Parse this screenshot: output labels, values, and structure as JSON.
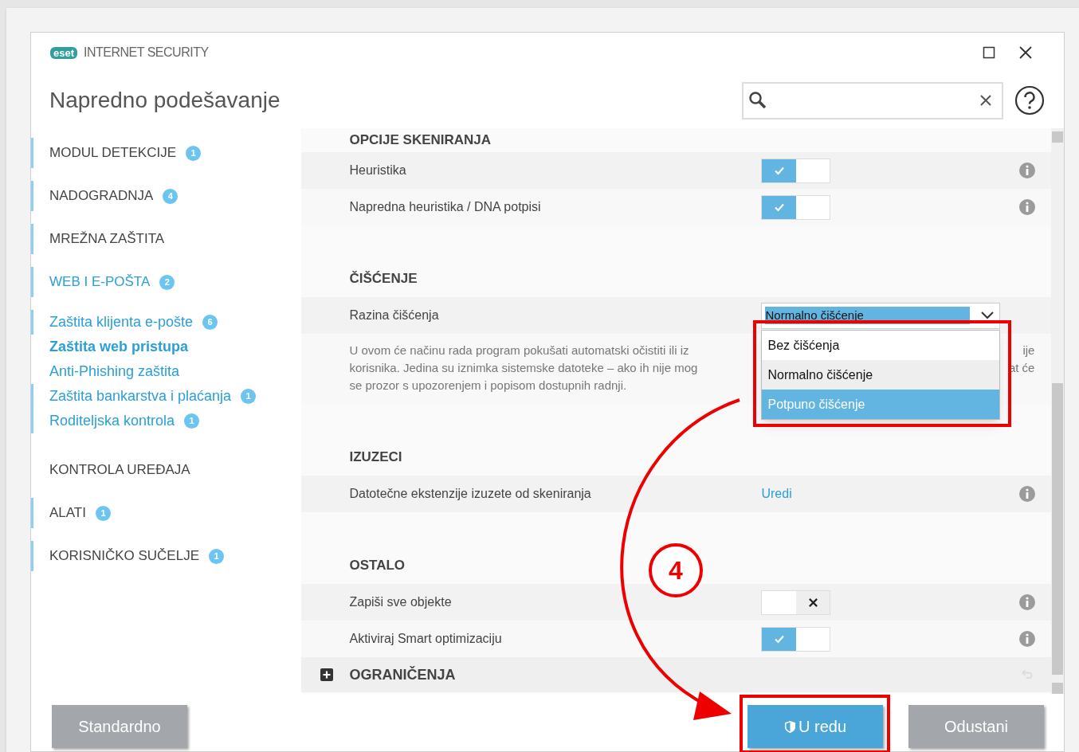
{
  "window": {
    "logo": "eset",
    "product": "INTERNET SECURITY",
    "title": "Napredno podešavanje"
  },
  "sidebar": {
    "items": [
      {
        "label": "MODUL DETEKCIJE",
        "badge": "1",
        "flagged": true,
        "selected": false
      },
      {
        "label": "NADOGRADNJA",
        "badge": "4",
        "flagged": true,
        "selected": false
      },
      {
        "label": "MREŽNA ZAŠTITA",
        "flagged": true,
        "selected": false
      },
      {
        "label": "WEB I E-POŠTA",
        "badge": "2",
        "flagged": true,
        "selected": true,
        "children": [
          {
            "label": "Zaštita klijenta e-pošte",
            "badge": "6",
            "flagged": true,
            "selected": false
          },
          {
            "label": "Zaštita web pristupa",
            "flagged": false,
            "selected": true
          },
          {
            "label": "Anti-Phishing zaštita",
            "flagged": false,
            "selected": false
          },
          {
            "label": "Zaštita bankarstva i plaćanja",
            "badge": "1",
            "flagged": true,
            "selected": false
          },
          {
            "label": "Roditeljska kontrola",
            "badge": "1",
            "flagged": true,
            "selected": false
          }
        ]
      },
      {
        "label": "KONTROLA UREĐAJA",
        "flagged": false,
        "selected": false
      },
      {
        "label": "ALATI",
        "badge": "1",
        "flagged": true,
        "selected": false
      },
      {
        "label": "KORISNIČKO SUČELJE",
        "badge": "1",
        "flagged": true,
        "selected": false
      }
    ]
  },
  "sections": [
    {
      "title": "OPCIJE SKENIRANJA",
      "rows": [
        {
          "kind": "toggle",
          "label": "Heuristika",
          "on": true
        },
        {
          "kind": "toggle",
          "label": "Napredna heuristika / DNA potpisi",
          "on": true
        }
      ]
    },
    {
      "title": "ČIŠĆENJE",
      "rows": [
        {
          "kind": "select",
          "label": "Razina čišćenja",
          "value": "Normalno čišćenje",
          "options": [
            {
              "label": "Bez čišćenja",
              "selected": false,
              "highlighted": false
            },
            {
              "label": "Normalno čišćenje",
              "selected": true,
              "highlighted": false
            },
            {
              "label": "Potpuno čišćenje",
              "selected": false,
              "highlighted": true
            }
          ]
        },
        {
          "kind": "description",
          "lines": [
            "U ovom će načinu rada program pokušati automatski očistiti ili iz",
            "korisnika. Jedina su iznimka sistemske datoteke – ako ih nije mog",
            "se prozor s upozorenjem i popisom dostupnih radnji."
          ],
          "tail": [
            "ije",
            "at će"
          ]
        }
      ]
    },
    {
      "title": "IZUZECI",
      "rows": [
        {
          "kind": "link",
          "label": "Datotečne ekstenzije izuzete od skeniranja",
          "link": "Uredi"
        }
      ]
    },
    {
      "title": "OSTALO",
      "rows": [
        {
          "kind": "toggle",
          "label": "Zapiši sve objekte",
          "on": false
        },
        {
          "kind": "toggle",
          "label": "Aktiviraj Smart optimizaciju",
          "on": true
        }
      ]
    },
    {
      "title": "OGRANIČENJA",
      "collapsed": true
    }
  ],
  "buttons": [
    {
      "label": "Standardno",
      "kind": "secondary"
    },
    {
      "label": "U redu",
      "kind": "primary"
    },
    {
      "label": "Odustani",
      "kind": "secondary"
    }
  ],
  "annotation": {
    "step": "4"
  }
}
